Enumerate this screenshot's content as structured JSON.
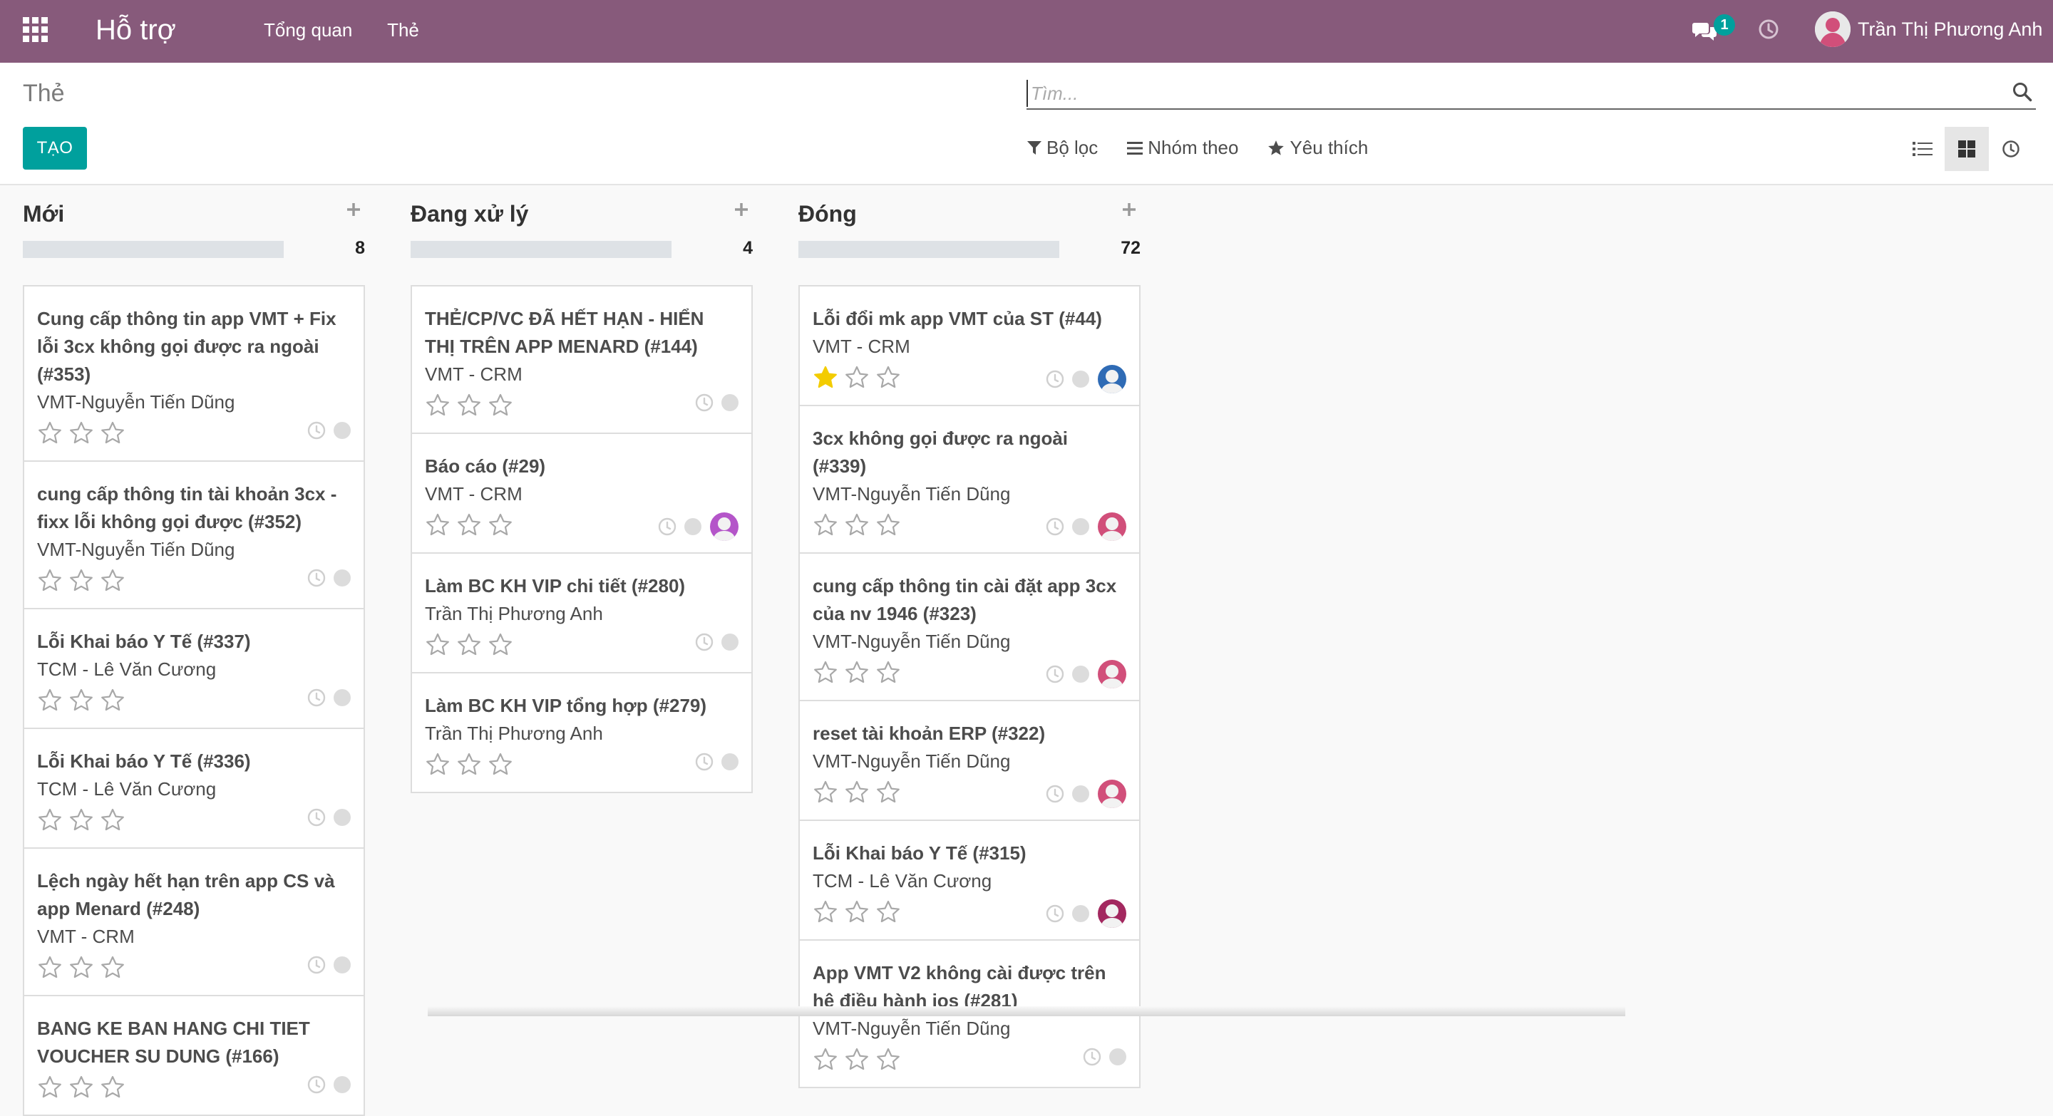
{
  "navbar": {
    "app_name": "Hỗ trợ",
    "menu": [
      "Tổng quan",
      "Thẻ"
    ],
    "chat_count": "1",
    "user_name": "Trần Thị Phương Anh"
  },
  "control": {
    "breadcrumb": "Thẻ",
    "create_label": "TẠO",
    "search_placeholder": "Tìm...",
    "filters": [
      "Bộ lọc",
      "Nhóm theo",
      "Yêu thích"
    ]
  },
  "colors": {
    "brand": "#875a7b",
    "accent": "#00a09d",
    "star_on": "#f3cc00",
    "star_off": "#a8a8a8"
  },
  "columns": [
    {
      "title": "Mới",
      "count": "8",
      "cards": [
        {
          "title": "Cung cấp thông tin app VMT + Fix lỗi 3cx không gọi được ra ngoài (#353)",
          "sub": "VMT-Nguyễn Tiến Dũng",
          "stars": 0,
          "avatar": "none"
        },
        {
          "title": "cung cấp thông tin tài khoản 3cx - fixx lỗi không gọi được (#352)",
          "sub": "VMT-Nguyễn Tiến Dũng",
          "stars": 0,
          "avatar": "none"
        },
        {
          "title": "Lỗi Khai báo Y Tế (#337)",
          "sub": "TCM - Lê Văn Cương",
          "stars": 0,
          "avatar": "none"
        },
        {
          "title": "Lỗi Khai báo Y Tế (#336)",
          "sub": "TCM - Lê Văn Cương",
          "stars": 0,
          "avatar": "none"
        },
        {
          "title": "Lệch ngày hết hạn trên app CS và app Menard (#248)",
          "sub": "VMT - CRM",
          "stars": 0,
          "avatar": "none"
        },
        {
          "title": "BANG KE BAN HANG CHI TIET VOUCHER SU DUNG (#166)",
          "sub": "",
          "stars": 0,
          "avatar": "none"
        }
      ]
    },
    {
      "title": "Đang xử lý",
      "count": "4",
      "cards": [
        {
          "title": "THẺ/CP/VC ĐÃ HẾT HẠN - HIỂN THỊ TRÊN APP MENARD (#144)",
          "sub": "VMT - CRM",
          "stars": 0,
          "avatar": "none"
        },
        {
          "title": "Báo cáo (#29)",
          "sub": "VMT - CRM",
          "stars": 0,
          "avatar": "purple"
        },
        {
          "title": "Làm BC KH VIP chi tiết (#280)",
          "sub": "Trần Thị Phương Anh",
          "stars": 0,
          "avatar": "none"
        },
        {
          "title": "Làm BC KH VIP tổng hợp (#279)",
          "sub": "Trần Thị Phương Anh",
          "stars": 0,
          "avatar": "none"
        }
      ]
    },
    {
      "title": "Đóng",
      "count": "72",
      "cards": [
        {
          "title": "Lỗi đổi mk app VMT của ST (#44)",
          "sub": "VMT - CRM",
          "stars": 1,
          "avatar": "blue"
        },
        {
          "title": "3cx không gọi được ra ngoài (#339)",
          "sub": "VMT-Nguyễn Tiến Dũng",
          "stars": 0,
          "avatar": "pink"
        },
        {
          "title": "cung cấp thông tin cài đặt app 3cx của nv 1946 (#323)",
          "sub": "VMT-Nguyễn Tiến Dũng",
          "stars": 0,
          "avatar": "pink"
        },
        {
          "title": "reset tài khoản ERP (#322)",
          "sub": "VMT-Nguyễn Tiến Dũng",
          "stars": 0,
          "avatar": "pink"
        },
        {
          "title": "Lỗi Khai báo Y Tế (#315)",
          "sub": "TCM - Lê Văn Cương",
          "stars": 0,
          "avatar": "magenta"
        },
        {
          "title": "App VMT V2 không cài được trên hệ điều hành ios (#281)",
          "sub": "VMT-Nguyễn Tiến Dũng",
          "stars": 0,
          "avatar": "none"
        }
      ]
    }
  ],
  "avatar_colors": {
    "blue": "#2f6bb5",
    "pink": "#d14f7a",
    "purple": "#b455c9",
    "magenta": "#a3285f"
  }
}
